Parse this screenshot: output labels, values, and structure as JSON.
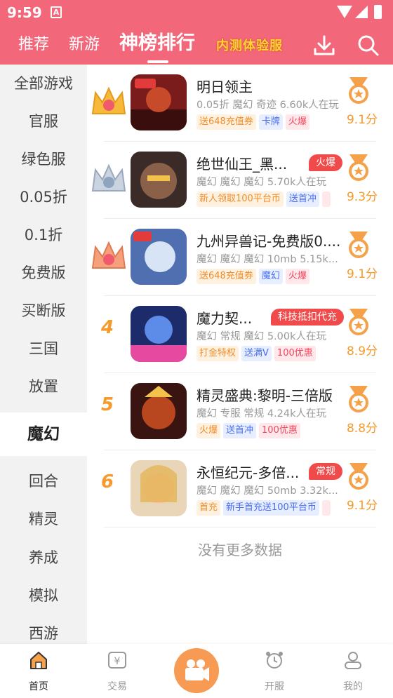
{
  "status_bar": {
    "time": "9:59",
    "sim_label": "A"
  },
  "top_nav": {
    "tabs": [
      {
        "label": "推荐"
      },
      {
        "label": "新游"
      },
      {
        "label": "神榜排行"
      },
      {
        "label": "内测体验服"
      }
    ],
    "active_tab": "神榜排行"
  },
  "sidebar": {
    "items": [
      {
        "label": "全部游戏"
      },
      {
        "label": "官服"
      },
      {
        "label": "绿色服"
      },
      {
        "label": "0.05折"
      },
      {
        "label": "0.1折"
      },
      {
        "label": "免费版"
      },
      {
        "label": "买断版"
      },
      {
        "label": "三国"
      },
      {
        "label": "放置"
      },
      {
        "label": "魔幻"
      },
      {
        "label": "回合"
      },
      {
        "label": "精灵"
      },
      {
        "label": "养成"
      },
      {
        "label": "模拟"
      },
      {
        "label": "西游"
      }
    ],
    "active": "魔幻"
  },
  "games": [
    {
      "rank": "1",
      "name": "明日领主",
      "badge": "",
      "meta": "0.05折 魔幻 奇迹  6.60k人在玩",
      "tags": [
        {
          "text": "送648充值券",
          "color": "orange"
        },
        {
          "text": "卡牌",
          "color": "blue"
        },
        {
          "text": "火爆",
          "color": "red"
        }
      ],
      "score": "9.1分",
      "thumb_text": "0.05折"
    },
    {
      "rank": "2",
      "name": "绝世仙王_黑...",
      "badge": "火爆",
      "meta": "魔幻 魔幻 魔幻  5.70k人在玩",
      "tags": [
        {
          "text": "新人领取100平台币",
          "color": "orange"
        },
        {
          "text": "送首冲",
          "color": "blue"
        },
        {
          "text": "",
          "color": "red"
        }
      ],
      "score": "9.3分",
      "thumb_text": ""
    },
    {
      "rank": "3",
      "name": "九州异兽记-免费版0....",
      "badge": "",
      "meta": "魔幻 魔幻 魔幻 10mb 5.15k...",
      "tags": [
        {
          "text": "送648充值券",
          "color": "orange"
        },
        {
          "text": "魔幻",
          "color": "blue"
        },
        {
          "text": "火爆",
          "color": "red"
        }
      ],
      "score": "9.1分",
      "thumb_text": "0.1折"
    },
    {
      "rank": "4",
      "name": "魔力契...",
      "badge": "科技抵扣代充",
      "meta": "魔幻 常规 魔幻  5.00k人在玩",
      "tags": [
        {
          "text": "打金特权",
          "color": "orange"
        },
        {
          "text": "送满V",
          "color": "blue"
        },
        {
          "text": "100优惠",
          "color": "red"
        }
      ],
      "score": "8.9分",
      "thumb_text": "科技代充"
    },
    {
      "rank": "5",
      "name": "精灵盛典:黎明-三倍版",
      "badge": "",
      "meta": "魔幻 专服 常规  4.24k人在玩",
      "tags": [
        {
          "text": "火爆",
          "color": "orange"
        },
        {
          "text": "送首冲",
          "color": "blue"
        },
        {
          "text": "100优惠",
          "color": "red"
        }
      ],
      "score": "8.8分",
      "thumb_text": ""
    },
    {
      "rank": "6",
      "name": "永恒纪元-多倍...",
      "badge": "常规",
      "meta": "魔幻 魔幻 魔幻 50mb 3.32k...",
      "tags": [
        {
          "text": "首充",
          "color": "orange"
        },
        {
          "text": "新手首充送100平台币",
          "color": "blue"
        },
        {
          "text": "",
          "color": "red"
        }
      ],
      "score": "9.1分",
      "thumb_text": ""
    }
  ],
  "no_more_text": "没有更多数据",
  "bottom_nav": {
    "items": [
      {
        "label": "首页",
        "icon": "home-icon"
      },
      {
        "label": "交易",
        "icon": "trade-icon"
      },
      {
        "label": "",
        "icon": "video-camera-icon"
      },
      {
        "label": "开服",
        "icon": "alarm-clock-icon"
      },
      {
        "label": "我的",
        "icon": "profile-icon"
      }
    ],
    "active": "首页"
  },
  "colors": {
    "brand": "#f3677a",
    "score": "#f59a2b",
    "center_button": "#f79a53",
    "sidebar_bg": "#f2f2f2"
  }
}
